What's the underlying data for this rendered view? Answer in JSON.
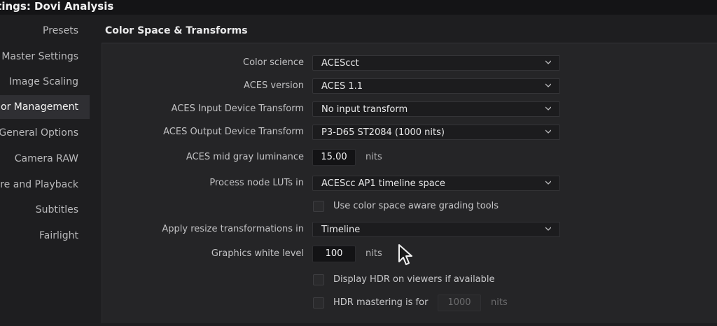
{
  "window": {
    "title": "ttings:  Dovi Analysis"
  },
  "sidebar": {
    "items": [
      {
        "label": "Presets"
      },
      {
        "label": "Master Settings"
      },
      {
        "label": "Image Scaling"
      },
      {
        "label": "olor Management"
      },
      {
        "label": "General Options"
      },
      {
        "label": "Camera RAW"
      },
      {
        "label": "ure and Playback"
      },
      {
        "label": "Subtitles"
      },
      {
        "label": "Fairlight"
      }
    ],
    "active_index": 3
  },
  "section": {
    "title": "Color Space & Transforms"
  },
  "settings": {
    "color_science": {
      "label": "Color science",
      "value": "ACEScct"
    },
    "aces_version": {
      "label": "ACES version",
      "value": "ACES 1.1"
    },
    "input_transform": {
      "label": "ACES Input Device Transform",
      "value": "No input transform"
    },
    "output_transform": {
      "label": "ACES Output Device Transform",
      "value": "P3-D65 ST2084 (1000 nits)"
    },
    "mid_gray": {
      "label": "ACES mid gray luminance",
      "value": "15.00",
      "unit": "nits"
    },
    "process_luts": {
      "label": "Process node LUTs in",
      "value": "ACEScc AP1 timeline space"
    },
    "color_space_aware": {
      "label": "Use color space aware grading tools",
      "checked": false
    },
    "resize_transform": {
      "label": "Apply resize transformations in",
      "value": "Timeline"
    },
    "graphics_white": {
      "label": "Graphics white level",
      "value": "100",
      "unit": "nits"
    },
    "display_hdr": {
      "label": "Display HDR on viewers if available",
      "checked": false
    },
    "hdr_mastering": {
      "label": "HDR mastering is for",
      "value": "1000",
      "unit": "nits",
      "checked": false
    }
  },
  "colors": {
    "background": "#1e1e20",
    "panel": "#252527",
    "titlebar": "#141416",
    "active_nav": "#2f2f33"
  },
  "icons": {
    "dropdown": "chevron-down-icon",
    "pointer": "mouse-cursor-icon"
  }
}
